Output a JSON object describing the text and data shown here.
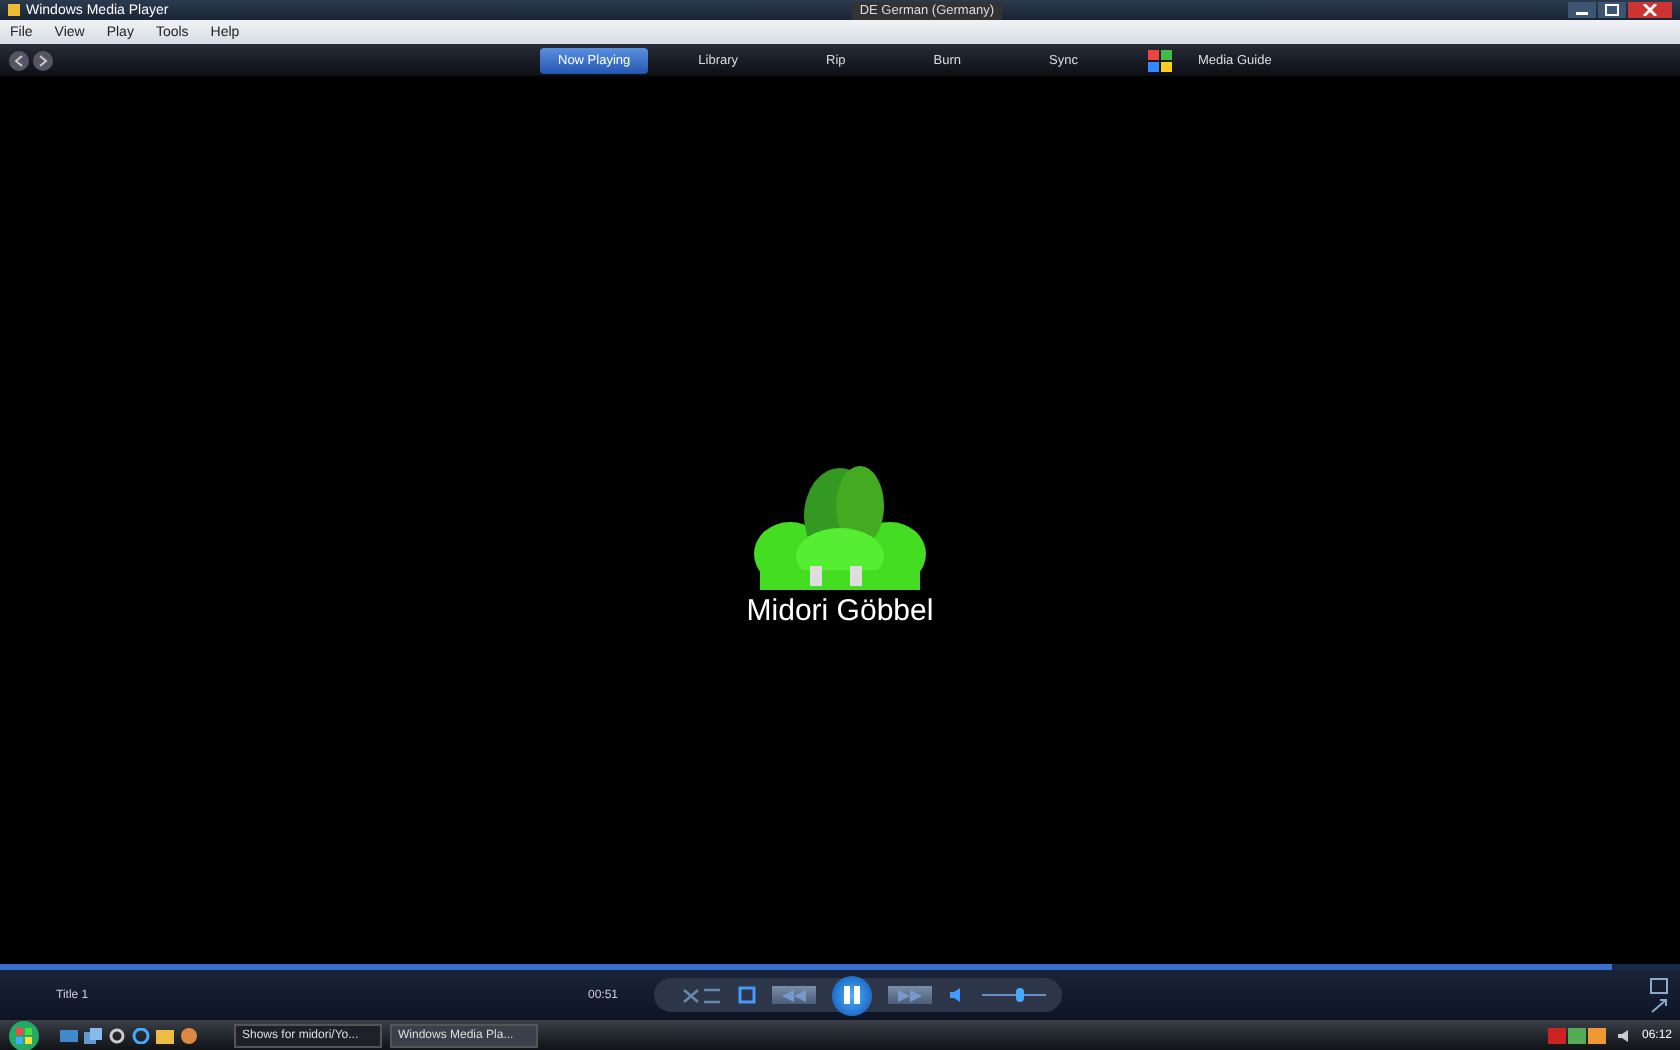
{
  "window": {
    "title": "Windows Media Player"
  },
  "language_bar": {
    "label": "DE German (Germany)"
  },
  "menu": [
    "File",
    "View",
    "Play",
    "Tools",
    "Help"
  ],
  "tabs": [
    {
      "label": "Now Playing",
      "selected": true
    },
    {
      "label": "Library",
      "selected": false
    },
    {
      "label": "Rip",
      "selected": false
    },
    {
      "label": "Burn",
      "selected": false
    },
    {
      "label": "Sync",
      "selected": false
    },
    {
      "label": "Media Guide",
      "selected": false
    }
  ],
  "now_playing": {
    "artist": "Midori Göbbel"
  },
  "seek": {
    "level": 0.96
  },
  "controls": {
    "status": "Title 1",
    "time": "00:51",
    "volume": {
      "level": 0.6
    }
  },
  "taskbar": {
    "buttons": [
      {
        "label": "Shows for midori/Yo...",
        "selected": false
      },
      {
        "label": "Windows Media Pla...",
        "selected": true
      }
    ],
    "clock": "06:12"
  }
}
